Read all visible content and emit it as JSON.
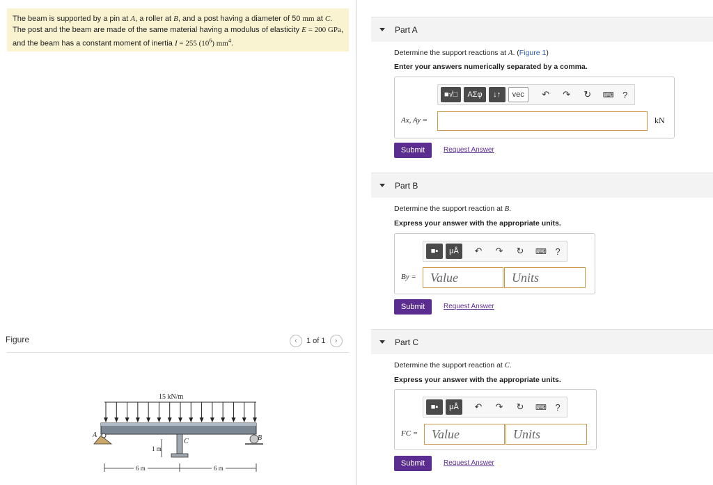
{
  "problem": {
    "line1": {
      "t1": "The beam is supported by a pin at ",
      "a": "A",
      "t2": ", a roller at ",
      "b": "B",
      "t3": ", and a post having a diameter of 50 ",
      "mm": "mm",
      "t4": " at ",
      "c": "C",
      "t5": "."
    },
    "line2": {
      "t1": "The post and the beam are made of the same material having a modulus of elasticity ",
      "e": "E",
      "t2": " = 200 ",
      "gpa": "GPa",
      "t3": ","
    },
    "line3": {
      "t1": "and the beam has a constant moment of inertia ",
      "i": "I",
      "t2": " = 255 (10",
      "exp": "6",
      "t3": ") mm",
      "exp2": "4",
      "t4": "."
    }
  },
  "figure": {
    "label": "Figure",
    "pager": "1 of 1",
    "prev_icon": "chevron-left-icon",
    "next_icon": "chevron-right-icon",
    "load_label": "15 kN/m",
    "label_a": "A",
    "label_b": "B",
    "label_c": "C",
    "dim_post": "1 m",
    "dim_left": "6 m",
    "dim_right": "6 m"
  },
  "parts": [
    {
      "title": "Part A",
      "question": {
        "t1": "Determine the support reactions at ",
        "var": "A",
        "t2": ". (",
        "link": "Figure 1",
        "t3": ")"
      },
      "instruction": "Enter your answers numerically separated by a comma.",
      "toolbar": {
        "b1": "■√□",
        "b2": "ΑΣφ",
        "b3": "↓↑",
        "b4": "vec",
        "undo": "↶",
        "redo": "↷",
        "reset": "↻",
        "keyboard": "⌨",
        "help": "?"
      },
      "input_label": "Ax, Ay =",
      "unit": "kN",
      "submit": "Submit",
      "request": "Request Answer"
    },
    {
      "title": "Part B",
      "question": {
        "t1": "Determine the support reaction at ",
        "var": "B",
        "t2": "."
      },
      "instruction": "Express your answer with the appropriate units.",
      "toolbar": {
        "b1": "■▪",
        "b2": "μÅ",
        "undo": "↶",
        "redo": "↷",
        "reset": "↻",
        "keyboard": "⌨",
        "help": "?"
      },
      "input_label": "By =",
      "value_placeholder": "Value",
      "units_placeholder": "Units",
      "submit": "Submit",
      "request": "Request Answer"
    },
    {
      "title": "Part C",
      "question": {
        "t1": "Determine the support reaction at ",
        "var": "C",
        "t2": "."
      },
      "instruction": "Express your answer with the appropriate units.",
      "toolbar": {
        "b1": "■▪",
        "b2": "μÅ",
        "undo": "↶",
        "redo": "↷",
        "reset": "↻",
        "keyboard": "⌨",
        "help": "?"
      },
      "input_label": "FC =",
      "value_placeholder": "Value",
      "units_placeholder": "Units",
      "submit": "Submit",
      "request": "Request Answer"
    }
  ],
  "colors": {
    "problem_bg": "#f9f3d2",
    "submit": "#5c2d91",
    "input_border": "#c89a4a"
  }
}
